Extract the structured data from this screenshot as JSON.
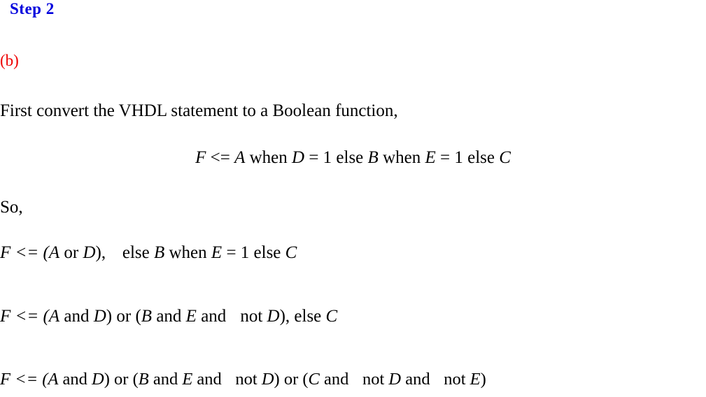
{
  "document": {
    "background_color": "#ffffff",
    "text_color": "#000000"
  },
  "heading": {
    "label": "Step 2",
    "color": "#0000dd"
  },
  "part": {
    "label": "(b)",
    "color": "#ee0000"
  },
  "prose": {
    "intro": "First convert the VHDL statement to a Boolean function,",
    "so": "So,"
  },
  "equations": {
    "display": {
      "plain": "F <= A when D = 1 else B when E = 1 else C",
      "tokens": [
        {
          "t": "F",
          "style": "var"
        },
        {
          "t": " <= ",
          "style": "op"
        },
        {
          "t": "A",
          "style": "var"
        },
        {
          "t": " when ",
          "style": "op"
        },
        {
          "t": "D",
          "style": "var"
        },
        {
          "t": " = 1 else ",
          "style": "op"
        },
        {
          "t": "B",
          "style": "var"
        },
        {
          "t": " when ",
          "style": "op"
        },
        {
          "t": "E",
          "style": "var"
        },
        {
          "t": " = 1 else ",
          "style": "op"
        },
        {
          "t": "C",
          "style": "var"
        }
      ]
    },
    "line1": {
      "plain": "F <= (A or D),   else B when E = 1 else C",
      "parts": {
        "lhs": "F <= (",
        "a": "A",
        "or": " or ",
        "d": "D",
        "close": "),",
        "else1": "else ",
        "b": "B",
        "when": " when ",
        "e": "E",
        "eq1": " = 1 else ",
        "c": "C"
      }
    },
    "line2": {
      "plain": "F <= (A and D) or (B and E and   not D), else C",
      "parts": {
        "lhs": "F <= (",
        "a": "A",
        "and1": " and ",
        "d1": "D",
        "close1": ") or (",
        "b": "B",
        "and2": " and ",
        "e": "E",
        "and3": " and ",
        "not1": "not ",
        "d2": "D",
        "close2": "),",
        "else1": " else ",
        "c": "C"
      }
    },
    "line3": {
      "plain": "F <= (A and D) or (B and E and   not D) or (C and   not D and   not E)",
      "parts": {
        "lhs": "F <= (",
        "a": "A",
        "and1": " and ",
        "d1": "D",
        "close1": ") or (",
        "b": "B",
        "and2": " and ",
        "e1": "E",
        "and3": " and ",
        "not1": "not ",
        "d2": "D",
        "close2": ") or (",
        "c": "C",
        "and4": " and ",
        "not2": "not ",
        "d3": "D",
        "and5": " and ",
        "not3": "not ",
        "e2": "E",
        "close3": ")"
      }
    }
  }
}
